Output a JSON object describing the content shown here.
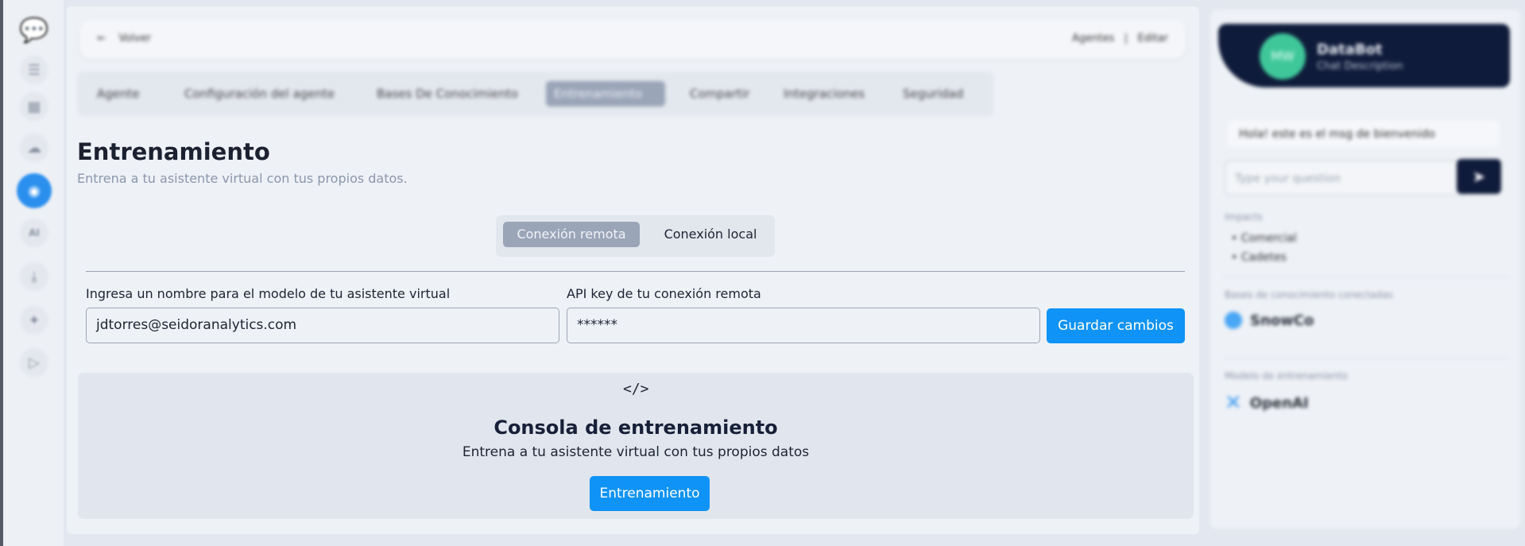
{
  "sidebar": {
    "icons": [
      "chat-bot-icon",
      "list-icon",
      "chart-icon",
      "cloud-icon",
      "agent-icon",
      "ai-icon",
      "download-icon",
      "sparkle-icon",
      "play-icon"
    ],
    "icon_glyphs": [
      "💬",
      "☰",
      "▦",
      "☁",
      "◉",
      "AI",
      "⤓",
      "✦",
      "▷"
    ],
    "active_index": 4
  },
  "topbar": {
    "back_arrow": "⇐",
    "back_label": "Volver",
    "crumb_1": "Agentes",
    "crumb_sep": "|",
    "crumb_2": "Editar"
  },
  "tabs": [
    {
      "label": "Agente"
    },
    {
      "label": "Configuración del agente"
    },
    {
      "label": "Bases De Conocimiento"
    },
    {
      "label": "Entrenamiento"
    },
    {
      "label": "Compartir"
    },
    {
      "label": "Integraciones"
    },
    {
      "label": "Seguridad"
    }
  ],
  "page": {
    "title": "Entrenamiento",
    "subtitle": "Entrena a tu asistente virtual con tus propios datos."
  },
  "connection_toggle": {
    "remote": "Conexión remota",
    "local": "Conexión local"
  },
  "form": {
    "name_label": "Ingresa un nombre para el modelo de tu asistente virtual",
    "name_value": "jdtorres@seidoranalytics.com",
    "api_label": "API key de tu conexión remota",
    "api_value": "******",
    "save_button": "Guardar cambios"
  },
  "console": {
    "icon": "</>",
    "title": "Consola de entrenamiento",
    "subtitle": "Entrena a tu asistente virtual con tus propios datos",
    "button": "Entrenamiento"
  },
  "preview": {
    "avatar_text": "MW",
    "bot_name": "DataBot",
    "bot_desc": "Chat Description",
    "welcome_msg": "Hola! este es el msg de bienvenido",
    "question_placeholder": "Type your question",
    "send_icon": "➤",
    "apps_label": "Impacts",
    "apps": [
      "Comercial",
      "Cadetes"
    ],
    "kb_label": "Bases de conocimiento conectadas",
    "kb_name": "SnowCo",
    "model_label": "Modelo de entrenamiento",
    "model_icon": "✕",
    "model_name": "OpenAI"
  },
  "colors": {
    "accent": "#0f93f6",
    "dark_navy": "#0f1b3a",
    "selected_tab": "#9aa5b8"
  }
}
